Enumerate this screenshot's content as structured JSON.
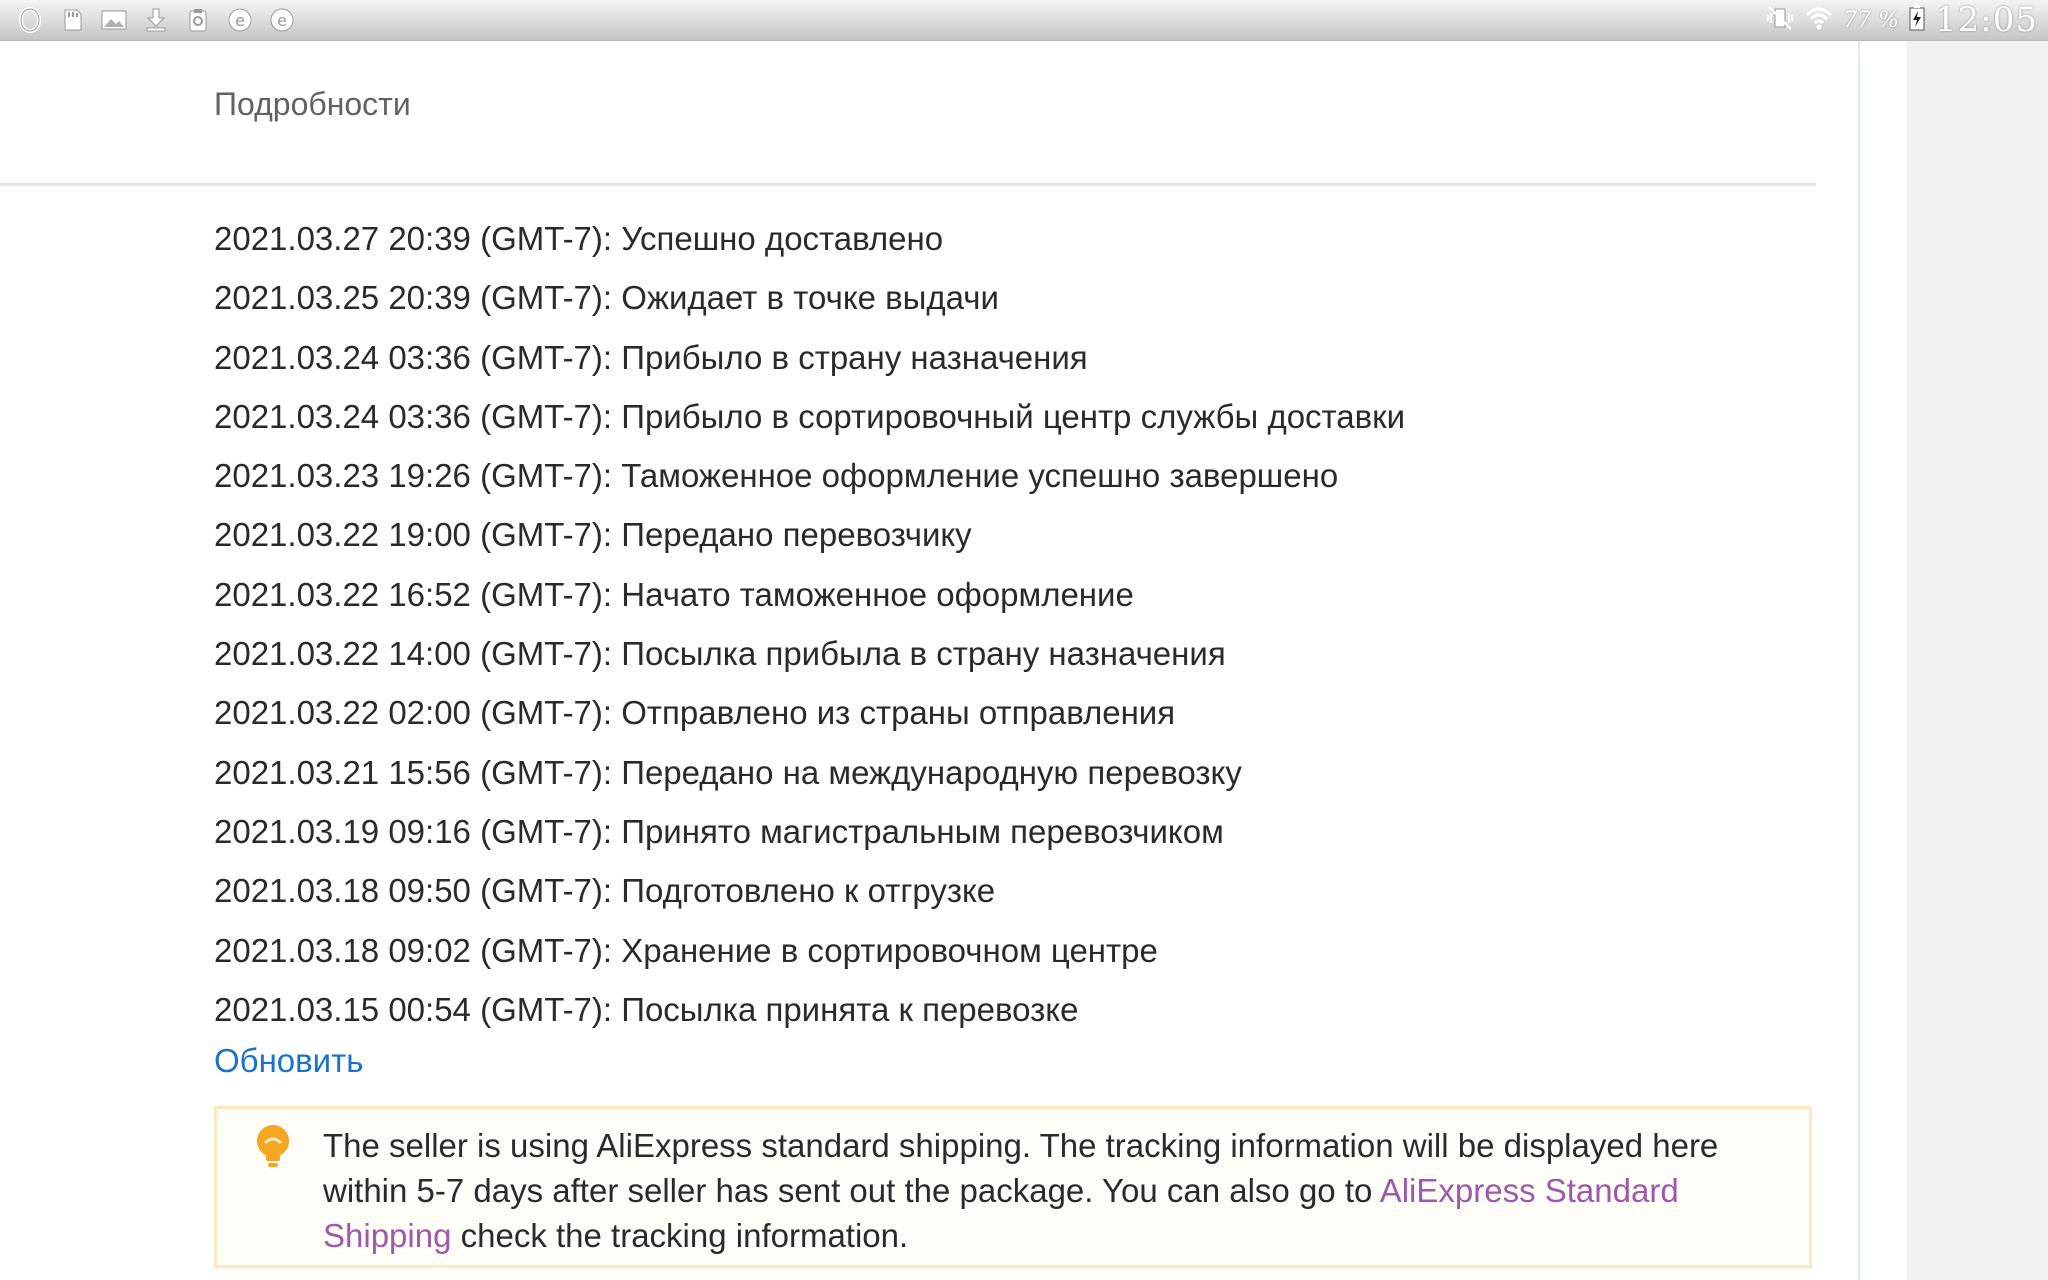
{
  "status_bar": {
    "icons": [
      "opera-icon",
      "sd-card-icon",
      "image-icon",
      "download-icon",
      "clipboard-icon",
      "e-browser-icon",
      "e-browser-icon-2"
    ],
    "battery_percent": "77 %",
    "clock": "12:05"
  },
  "details": {
    "title": "Подробности",
    "events": [
      {
        "time": "2021.03.27 20:39 (GMT-7):",
        "status": "Успешно доставлено"
      },
      {
        "time": "2021.03.25 20:39 (GMT-7):",
        "status": "Ожидает в точке выдачи"
      },
      {
        "time": "2021.03.24 03:36 (GMT-7):",
        "status": "Прибыло в страну назначения"
      },
      {
        "time": "2021.03.24 03:36 (GMT-7):",
        "status": "Прибыло в сортировочный центр службы доставки"
      },
      {
        "time": "2021.03.23 19:26 (GMT-7):",
        "status": "Таможенное оформление успешно завершено"
      },
      {
        "time": "2021.03.22 19:00 (GMT-7):",
        "status": "Передано перевозчику"
      },
      {
        "time": "2021.03.22 16:52 (GMT-7):",
        "status": "Начато таможенное оформление"
      },
      {
        "time": "2021.03.22 14:00 (GMT-7):",
        "status": "Посылка прибыла в страну назначения"
      },
      {
        "time": "2021.03.22 02:00 (GMT-7):",
        "status": "Отправлено из страны отправления"
      },
      {
        "time": "2021.03.21 15:56 (GMT-7):",
        "status": "Передано на международную перевозку"
      },
      {
        "time": "2021.03.19 09:16 (GMT-7):",
        "status": "Принято магистральным перевозчиком"
      },
      {
        "time": "2021.03.18 09:50 (GMT-7):",
        "status": "Подготовлено к отгрузке"
      },
      {
        "time": "2021.03.18 09:02 (GMT-7):",
        "status": "Хранение в сортировочном центре"
      },
      {
        "time": "2021.03.15 00:54 (GMT-7):",
        "status": "Посылка принята к перевозке"
      }
    ],
    "refresh_label": "Обновить"
  },
  "notice": {
    "icon": "lightbulb-icon",
    "text_before": "The seller is using AliExpress standard shipping. The tracking information will be displayed here within 5-7 days after seller has sent out the package. You can also go to ",
    "link_text": "AliExpress Standard Shipping",
    "text_after": " check the tracking information."
  },
  "colors": {
    "link_blue": "#1a73c8",
    "link_purple": "#9c5aa8",
    "notice_border": "#fbe9c3",
    "bulb_orange": "#f5a623"
  }
}
